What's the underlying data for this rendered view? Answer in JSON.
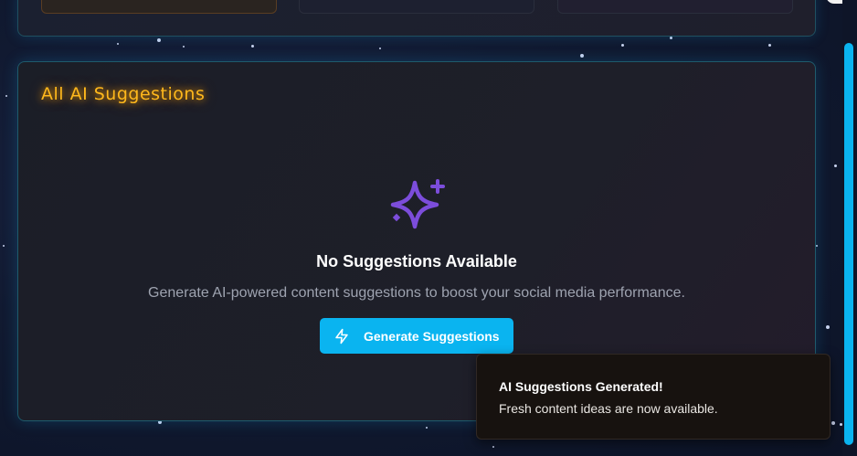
{
  "panel": {
    "title": "All AI Suggestions",
    "empty_state": {
      "icon": "sparkles-icon",
      "title": "No Suggestions Available",
      "description": "Generate AI-powered content suggestions to boost your social media performance.",
      "button_label": "Generate Suggestions",
      "button_icon": "zap-icon"
    }
  },
  "toast": {
    "title": "AI Suggestions Generated!",
    "description": "Fresh content ideas are now available."
  },
  "colors": {
    "accent": "#0ab4f0",
    "title_glow": "#ffb81c",
    "sparkle_icon": "#7c4ddb",
    "toast_bg": "#17120f"
  }
}
